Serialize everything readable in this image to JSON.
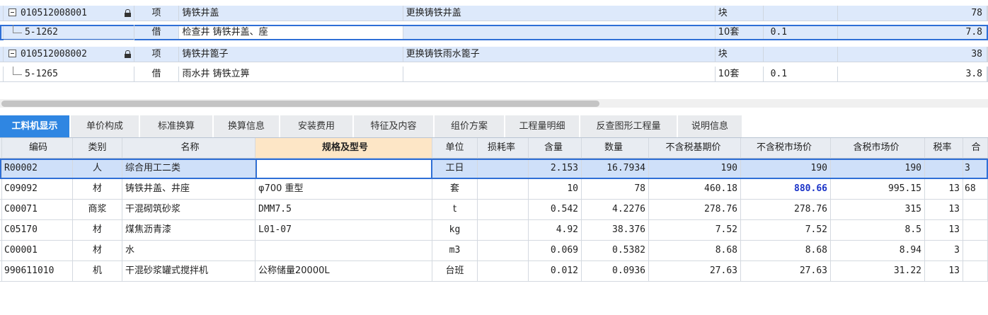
{
  "top_grid": {
    "rows": [
      {
        "code": "010512008001",
        "locked": true,
        "kind": "项",
        "name": "铸铁井盖",
        "desc": "更换铸铁井盖",
        "unit": "块",
        "qty": "",
        "amount": "78",
        "style": "blue",
        "type": "parent"
      },
      {
        "code": "5-1262",
        "locked": false,
        "kind": "借",
        "name": "检查井 铸铁井盖、座",
        "desc": "",
        "unit": "10套",
        "qty": "0.1",
        "amount": "7.8",
        "style": "selected",
        "type": "child"
      },
      {
        "code": "010512008002",
        "locked": true,
        "kind": "项",
        "name": "铸铁井篦子",
        "desc": "更换铸铁雨水篦子",
        "unit": "块",
        "qty": "",
        "amount": "38",
        "style": "blue",
        "type": "parent"
      },
      {
        "code": "5-1265",
        "locked": false,
        "kind": "借",
        "name": "雨水井 铸铁立箅",
        "desc": "",
        "unit": "10套",
        "qty": "0.1",
        "amount": "3.8",
        "style": "white",
        "type": "child"
      }
    ]
  },
  "tabs": [
    {
      "label": "工料机显示",
      "active": true
    },
    {
      "label": "单价构成",
      "active": false
    },
    {
      "label": "标准换算",
      "active": false
    },
    {
      "label": "换算信息",
      "active": false
    },
    {
      "label": "安装费用",
      "active": false
    },
    {
      "label": "特征及内容",
      "active": false
    },
    {
      "label": "组价方案",
      "active": false
    },
    {
      "label": "工程量明细",
      "active": false
    },
    {
      "label": "反查图形工程量",
      "active": false
    },
    {
      "label": "说明信息",
      "active": false
    }
  ],
  "table": {
    "headers": [
      "编码",
      "类别",
      "名称",
      "规格及型号",
      "单位",
      "损耗率",
      "含量",
      "数量",
      "不含税基期价",
      "不含税市场价",
      "含税市场价",
      "税率",
      "合"
    ],
    "rows": [
      {
        "code": "R00002",
        "type": "人",
        "name": "综合用工二类",
        "spec": "",
        "unit": "工日",
        "loss": "",
        "content": "2.153",
        "qty": "16.7934",
        "base_price": "190",
        "market_price": "190",
        "tax_price": "190",
        "tax_rate": "",
        "extra": "3"
      },
      {
        "code": "C09092",
        "type": "材",
        "name": "铸铁井盖、井座",
        "spec": "φ700 重型",
        "unit": "套",
        "loss": "",
        "content": "10",
        "qty": "78",
        "base_price": "460.18",
        "market_price": "880.66",
        "tax_price": "995.15",
        "tax_rate": "13",
        "extra": "68"
      },
      {
        "code": "C00071",
        "type": "商浆",
        "name": "干混砌筑砂浆",
        "spec": "DMM7.5",
        "unit": "t",
        "loss": "",
        "content": "0.542",
        "qty": "4.2276",
        "base_price": "278.76",
        "market_price": "278.76",
        "tax_price": "315",
        "tax_rate": "13",
        "extra": ""
      },
      {
        "code": "C05170",
        "type": "材",
        "name": "煤焦沥青漆",
        "spec": "L01-07",
        "unit": "kg",
        "loss": "",
        "content": "4.92",
        "qty": "38.376",
        "base_price": "7.52",
        "market_price": "7.52",
        "tax_price": "8.5",
        "tax_rate": "13",
        "extra": ""
      },
      {
        "code": "C00001",
        "type": "材",
        "name": "水",
        "spec": "",
        "unit": "m3",
        "loss": "",
        "content": "0.069",
        "qty": "0.5382",
        "base_price": "8.68",
        "market_price": "8.68",
        "tax_price": "8.94",
        "tax_rate": "3",
        "extra": ""
      },
      {
        "code": "990611010",
        "type": "机",
        "name": "干混砂浆罐式搅拌机",
        "spec": "公称储量20000L",
        "unit": "台班",
        "loss": "",
        "content": "0.012",
        "qty": "0.0936",
        "base_price": "27.63",
        "market_price": "27.63",
        "tax_price": "31.22",
        "tax_rate": "13",
        "extra": ""
      }
    ]
  },
  "colors": {
    "accent": "#2f86e2",
    "selection_border": "#2f6fd6",
    "row_highlight": "#dde9fb",
    "header_highlight": "#fde6c6",
    "emphasis_text": "#1a33c8"
  }
}
